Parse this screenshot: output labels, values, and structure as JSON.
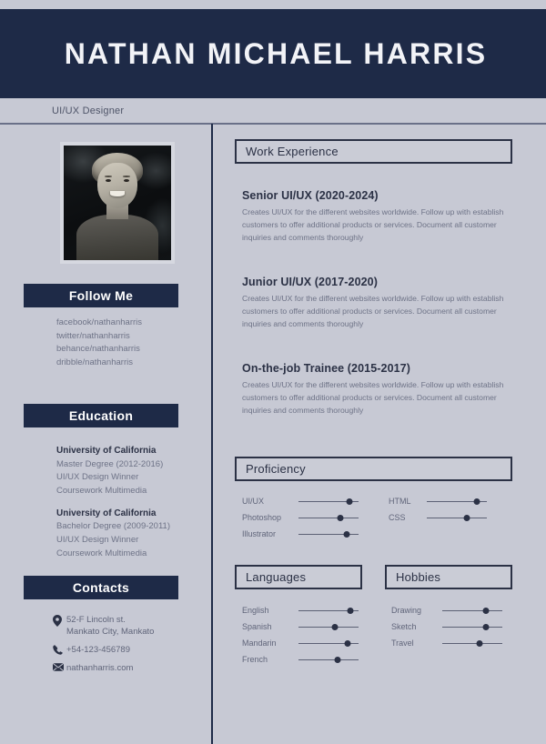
{
  "document": {
    "type": "resume",
    "colors": {
      "background": "#c7c9d4",
      "navy": "#1e2a47",
      "accent_dark": "#2b3145",
      "body_text": "#6e7387",
      "header_text": "#f2f3f7"
    }
  },
  "header": {
    "name": "NATHAN MICHAEL HARRIS",
    "job_title": "UI/UX Designer"
  },
  "sidebar": {
    "photo_alt": "profile-photo",
    "follow_me": {
      "heading": "Follow Me",
      "links": [
        "facebook/nathanharris",
        "twitter/nathanharris",
        "behance/nathanharris",
        "dribble/nathanharris"
      ]
    },
    "education": {
      "heading": "Education",
      "entries": [
        {
          "school": "University of California",
          "lines": [
            "Master Degree (2012-2016)",
            "UI/UX Design Winner",
            "Coursework Multimedia"
          ]
        },
        {
          "school": "University of California",
          "lines": [
            "Bachelor Degree (2009-2011)",
            "UI/UX Design Winner",
            "Coursework Multimedia"
          ]
        }
      ]
    },
    "contacts": {
      "heading": "Contacts",
      "items": [
        {
          "icon": "location-pin-icon",
          "line1": "52-F Lincoln st.",
          "line2": "Mankato City, Mankato"
        },
        {
          "icon": "phone-icon",
          "line1": "+54-123-456789",
          "line2": ""
        },
        {
          "icon": "envelope-icon",
          "line1": "nathanharris.com",
          "line2": ""
        }
      ]
    }
  },
  "main": {
    "work_experience": {
      "heading": "Work Experience",
      "jobs": [
        {
          "title": "Senior UI/UX (2020-2024)",
          "description": "Creates UI/UX for the different websites worldwide. Follow up with establish customers to offer additional products or services. Document all customer inquiries and comments thoroughly"
        },
        {
          "title": "Junior UI/UX (2017-2020)",
          "description": "Creates UI/UX for the different websites worldwide. Follow up with establish customers to offer additional products or services. Document all customer inquiries and comments thoroughly"
        },
        {
          "title": "On-the-job Trainee (2015-2017)",
          "description": "Creates UI/UX for the different websites worldwide. Follow up with establish customers to offer additional products or services. Document all customer inquiries and comments thoroughly"
        }
      ]
    },
    "proficiency": {
      "heading": "Proficiency",
      "left_skills": [
        {
          "label": "UI/UX",
          "value": 85
        },
        {
          "label": "Photoshop",
          "value": 70
        },
        {
          "label": "Illustrator",
          "value": 80
        }
      ],
      "right_skills": [
        {
          "label": "HTML",
          "value": 83
        },
        {
          "label": "CSS",
          "value": 67
        }
      ]
    },
    "languages": {
      "heading": "Languages",
      "skills": [
        {
          "label": "English",
          "value": 86
        },
        {
          "label": "Spanish",
          "value": 60
        },
        {
          "label": "Mandarin",
          "value": 82
        },
        {
          "label": "French",
          "value": 65
        }
      ]
    },
    "hobbies": {
      "heading": "Hobbies",
      "skills": [
        {
          "label": "Drawing",
          "value": 73
        },
        {
          "label": "Sketch",
          "value": 73
        },
        {
          "label": "Travel",
          "value": 62
        }
      ]
    }
  }
}
